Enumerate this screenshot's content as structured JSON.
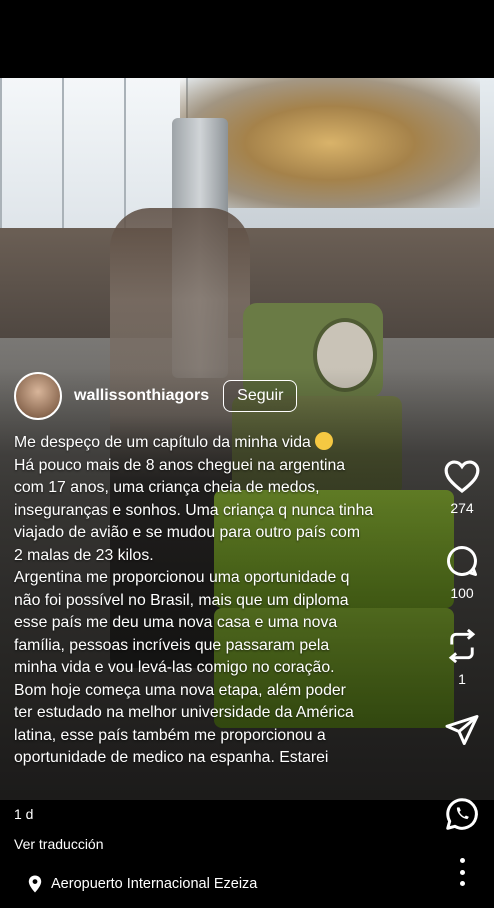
{
  "post": {
    "username": "wallissonthiagors",
    "follow_label": "Seguir",
    "caption_lines": [
      "Me despeço de um capítulo da minha vida",
      "Há pouco mais de 8 anos cheguei na argentina",
      "com 17 anos, uma criança cheia de medos,",
      "inseguranças e sonhos. Uma criança q nunca tinha",
      "viajado de avião e se mudou para outro país com",
      "2 malas de 23 kilos.",
      "Argentina me proporcionou uma oportunidade q",
      "não foi possível no Brasil, mais que um diploma",
      "esse país me deu uma nova casa e uma nova",
      "família, pessoas incríveis que passaram pela",
      "minha vida e vou levá-las comigo no coração.",
      "Bom hoje começa uma nova etapa, além poder",
      "ter estudado na melhor universidade da América",
      "latina, esse país também me proporcionou a",
      "oportunidade de medico na espanha. Estarei"
    ],
    "time_ago": "1 d",
    "translate_label": "Ver traducción",
    "location": "Aeropuerto Internacional Ezeiza"
  },
  "actions": {
    "likes": "274",
    "comments": "100",
    "reposts": "1"
  },
  "icons": [
    "heart-icon",
    "comment-icon",
    "repost-icon",
    "share-icon",
    "whatsapp-icon",
    "location-pin-icon",
    "more-options-icon"
  ]
}
